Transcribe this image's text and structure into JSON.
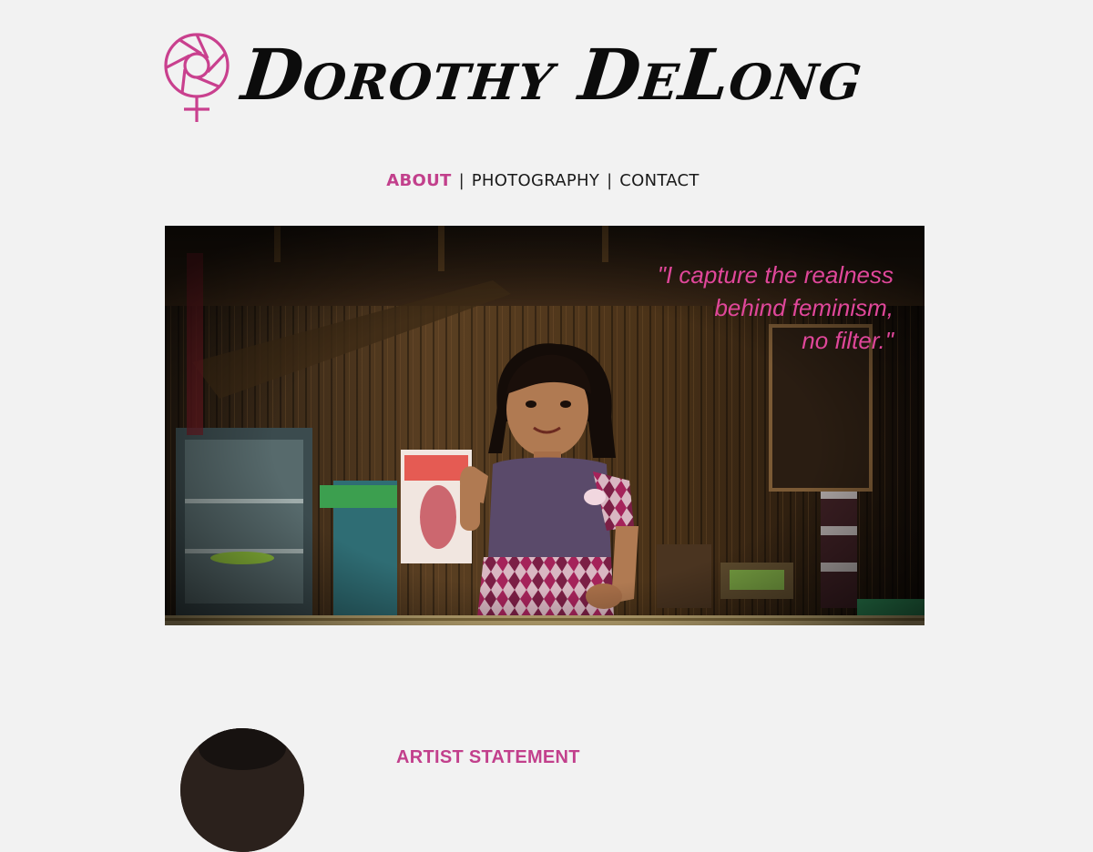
{
  "brand": {
    "name": "Dorothy DeLong",
    "logo_icon": "female-symbol-aperture-icon",
    "accent_color": "#c2408c"
  },
  "nav": {
    "items": [
      {
        "label": "ABOUT",
        "active": true
      },
      {
        "label": "PHOTOGRAPHY",
        "active": false
      },
      {
        "label": "CONTACT",
        "active": false
      }
    ],
    "separator": "|"
  },
  "hero": {
    "quote_lines": [
      "\"I capture the realness",
      "behind feminism,",
      "no filter.\""
    ],
    "quote_color": "#e0479a"
  },
  "about": {
    "heading": "ARTIST STATEMENT"
  }
}
